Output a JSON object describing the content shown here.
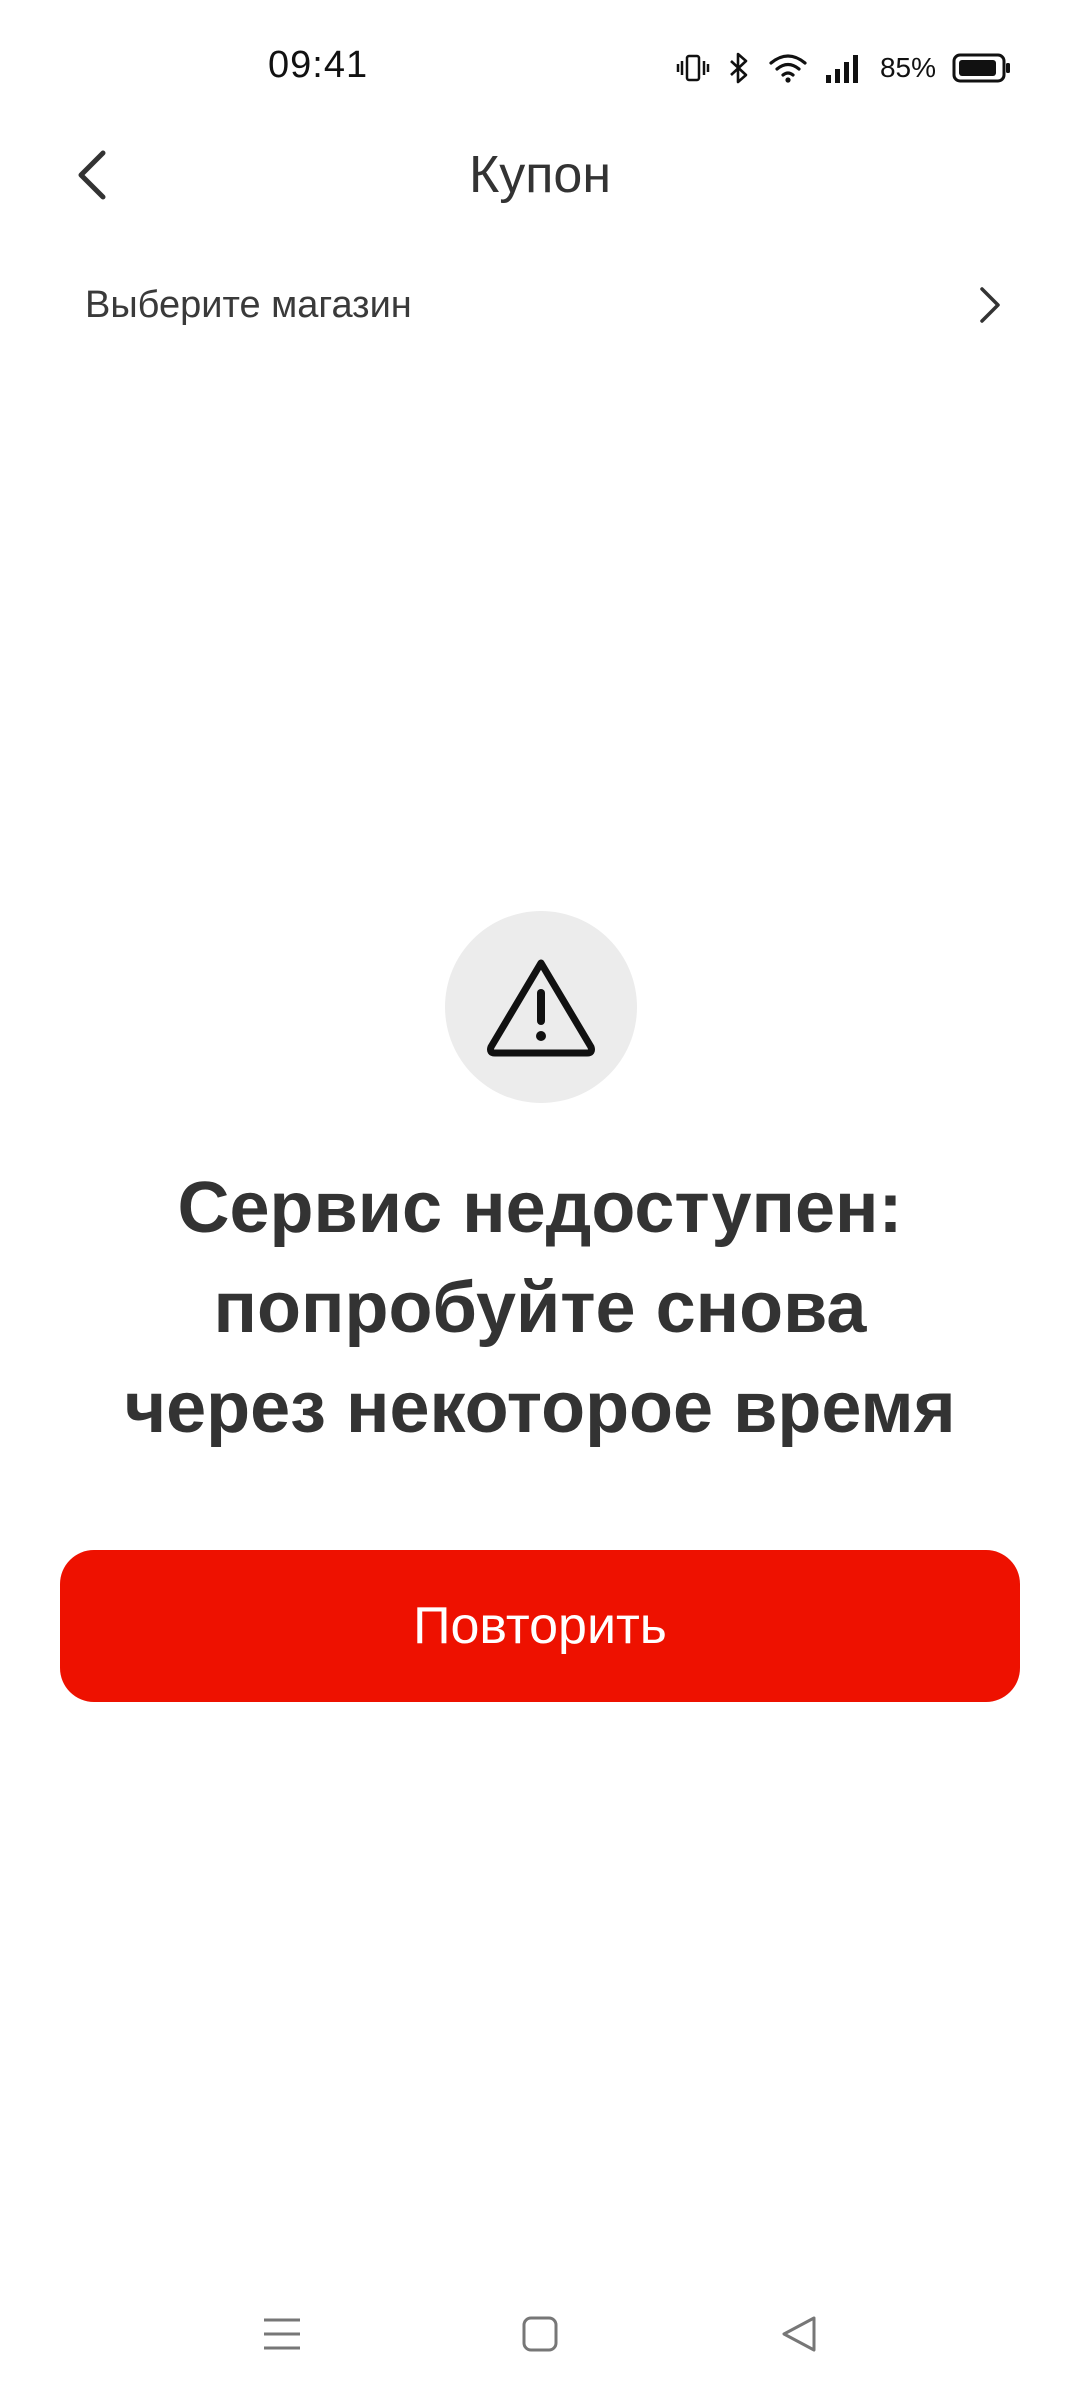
{
  "status_bar": {
    "time": "09:41",
    "battery_text": "85%",
    "icons": [
      "vibrate-icon",
      "bluetooth-icon",
      "wifi-icon",
      "signal-icon",
      "battery-icon"
    ]
  },
  "header": {
    "title": "Купон",
    "back_icon": "back-arrow-icon"
  },
  "store_selector": {
    "label": "Выберите магазин",
    "icon": "chevron-right-icon"
  },
  "error": {
    "icon": "warning-icon",
    "title_lines": [
      "Сервис недоступен:",
      "попробуйте снова",
      "через некоторое время"
    ]
  },
  "actions": {
    "retry_label": "Повторить",
    "accent_color": "#ee1100"
  },
  "nav_bar": {
    "buttons": [
      "menu-icon",
      "home-icon",
      "back-icon"
    ]
  }
}
